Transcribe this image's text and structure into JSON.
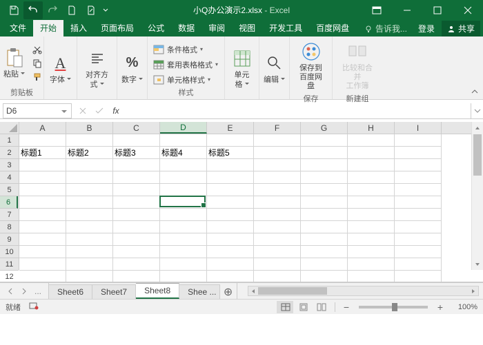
{
  "title": {
    "filename": "小Q办公演示2.xlsx",
    "app": "Excel",
    "sep": " - "
  },
  "qat": {
    "save": "save",
    "undo": "undo",
    "redo": "redo",
    "new": "new",
    "open": "open"
  },
  "tabs": {
    "file": "文件",
    "items": [
      "开始",
      "插入",
      "页面布局",
      "公式",
      "数据",
      "审阅",
      "视图",
      "开发工具",
      "百度网盘"
    ],
    "active": 0,
    "tell_me": "告诉我...",
    "login": "登录",
    "share": "共享"
  },
  "ribbon": {
    "clipboard": {
      "label": "剪贴板",
      "paste": "粘贴"
    },
    "font": {
      "label": "字体"
    },
    "align": {
      "label": "对齐方式"
    },
    "number": {
      "label": "数字"
    },
    "styles": {
      "label": "样式",
      "cond": "条件格式",
      "table": "套用表格格式",
      "cell": "单元格样式"
    },
    "cells": {
      "label": "单元格"
    },
    "edit": {
      "label": "编辑"
    },
    "baidu": {
      "label": "保存",
      "btn": "保存到\n百度网盘"
    },
    "newgroup": {
      "label": "新建组",
      "btn": "比较和合并\n工作簿"
    }
  },
  "formula": {
    "cell_ref": "D6",
    "fx": "fx",
    "value": ""
  },
  "grid": {
    "cols": [
      "A",
      "B",
      "C",
      "D",
      "E",
      "F",
      "G",
      "H",
      "I"
    ],
    "rows": [
      1,
      2,
      3,
      4,
      5,
      6,
      7,
      8,
      9,
      10,
      11,
      12
    ],
    "data": {
      "2": [
        "标题1",
        "标题2",
        "标题3",
        "标题4",
        "标题5"
      ]
    },
    "sel": {
      "col": 3,
      "row": 5
    }
  },
  "sheets": {
    "tabs": [
      "Sheet6",
      "Sheet7",
      "Sheet8",
      "Shee"
    ],
    "active": 2,
    "more": "..."
  },
  "status": {
    "ready": "就绪",
    "rec": "",
    "zoom": "100%"
  }
}
